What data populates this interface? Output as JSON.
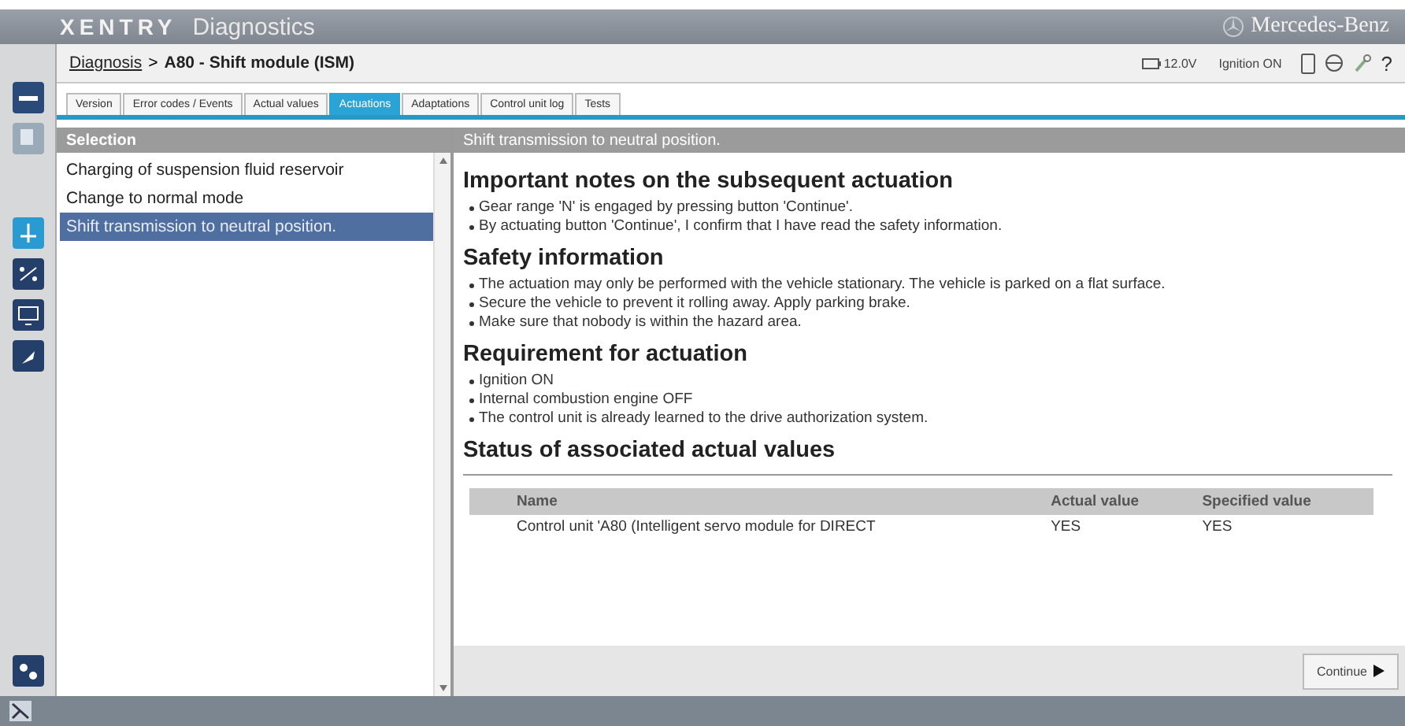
{
  "window": {
    "app_name": "XENTRY",
    "title": "Diagnostics",
    "brand": "Mercedes-Benz"
  },
  "breadcrumb": {
    "link": "Diagnosis",
    "separator": ">",
    "current": "A80 - Shift module (ISM)"
  },
  "vehicle_status": {
    "voltage": "12.0V",
    "ignition": "Ignition ON"
  },
  "help_label": "?",
  "tabs": [
    {
      "label": "Version",
      "selected": false
    },
    {
      "label": "Error codes / Events",
      "selected": false
    },
    {
      "label": "Actual values",
      "selected": false
    },
    {
      "label": "Actuations",
      "selected": true
    },
    {
      "label": "Adaptations",
      "selected": false
    },
    {
      "label": "Control unit log",
      "selected": false
    },
    {
      "label": "Tests",
      "selected": false
    }
  ],
  "selection": {
    "title": "Selection",
    "items": [
      {
        "label": "Charging of suspension fluid reservoir",
        "selected": false
      },
      {
        "label": "Change to normal mode",
        "selected": false
      },
      {
        "label": "Shift transmission to neutral position.",
        "selected": true
      }
    ]
  },
  "detail": {
    "title": "Shift transmission to neutral position.",
    "sections": [
      {
        "heading": "Important notes on the subsequent actuation",
        "bullets": [
          "Gear range 'N' is engaged by pressing button 'Continue'.",
          "By actuating button 'Continue', I confirm that I have read the safety information."
        ]
      },
      {
        "heading": "Safety information",
        "bullets": [
          "The actuation may only be performed with the vehicle stationary. The vehicle is parked on a flat surface.",
          "Secure the vehicle to prevent it rolling away. Apply parking brake.",
          "Make sure that nobody is within the hazard area."
        ]
      },
      {
        "heading": "Requirement for actuation",
        "bullets": [
          "Ignition ON",
          "Internal combustion engine OFF",
          "The control unit is already learned to the drive authorization system."
        ]
      },
      {
        "heading": "Status of associated actual values"
      }
    ],
    "table": {
      "columns": [
        "Name",
        "Actual value",
        "Specified value"
      ],
      "rows": [
        [
          "Control unit 'A80 (Intelligent servo module for DIRECT",
          "YES",
          "YES"
        ]
      ]
    },
    "continue_button": "Continue"
  }
}
